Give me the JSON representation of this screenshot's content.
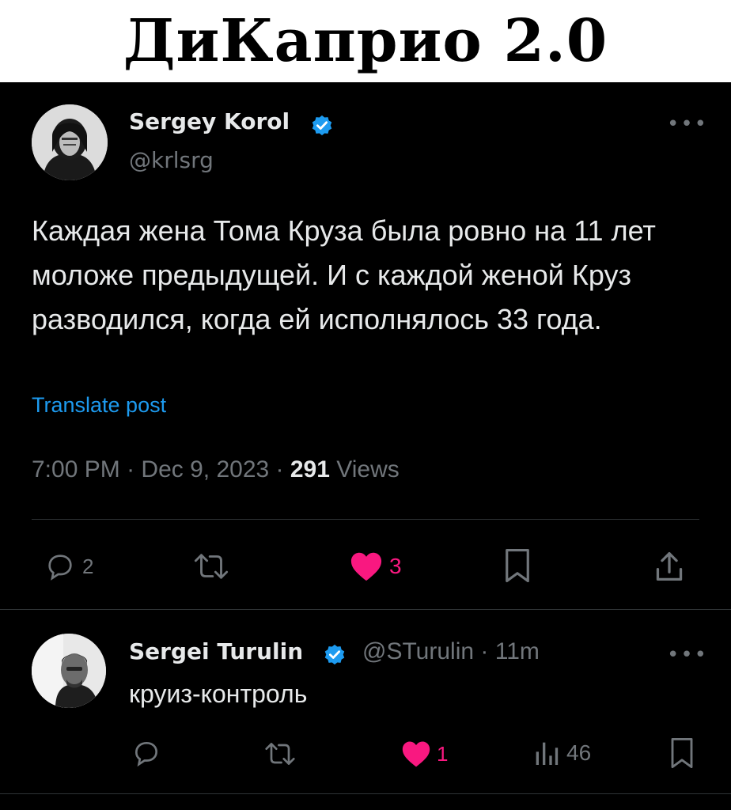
{
  "header": {
    "title": "ДиКаприо 2.0"
  },
  "tweet": {
    "author_name": "Sergey Korol",
    "handle": "@krlsrg",
    "more_icon": "more-horizontal-icon",
    "text": "Каждая жена Тома Круза была ровно на 11 лет моложе предыдущей. И с каждой женой Круз разводился, когда ей исполнялось 33 года.",
    "translate_label": "Translate post",
    "time": "7:00 PM",
    "date": "Dec 9, 2023",
    "views_count": "291",
    "views_label": "Views",
    "actions": {
      "reply_count": "2",
      "retweet_count": "",
      "like_count": "3",
      "bookmark_count": "",
      "share_count": ""
    }
  },
  "reply": {
    "author_name": "Sergei Turulin",
    "handle": "@STurulin",
    "time": "11m",
    "text": "круиз-контроль",
    "actions": {
      "reply_count": "",
      "retweet_count": "",
      "like_count": "1",
      "views_count": "46"
    }
  },
  "colors": {
    "background": "#000000",
    "text": "#e7e9ea",
    "muted": "#71767b",
    "accent_blue": "#1d9bf0",
    "like_pink": "#f91880",
    "divider": "#2f3336"
  }
}
